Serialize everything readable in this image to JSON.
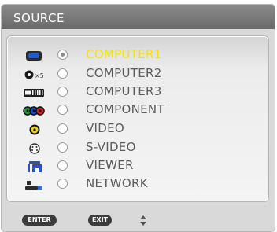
{
  "window": {
    "title": "SOURCE"
  },
  "sources": [
    {
      "label": "COMPUTER1",
      "selected": true,
      "icon": "computer-port-icon"
    },
    {
      "label": "COMPUTER2",
      "selected": false,
      "icon": "bnc-x5-icon",
      "icon_text": "×5"
    },
    {
      "label": "COMPUTER3",
      "selected": false,
      "icon": "dvi-port-icon"
    },
    {
      "label": "COMPONENT",
      "selected": false,
      "icon": "component-rca-icon"
    },
    {
      "label": "VIDEO",
      "selected": false,
      "icon": "video-rca-icon"
    },
    {
      "label": "S-VIDEO",
      "selected": false,
      "icon": "s-video-icon"
    },
    {
      "label": "VIEWER",
      "selected": false,
      "icon": "viewer-icon"
    },
    {
      "label": "NETWORK",
      "selected": false,
      "icon": "network-icon"
    }
  ],
  "footer": {
    "enter_label": "ENTER",
    "exit_label": "EXIT",
    "nav_icon": "up-down-arrows-icon"
  },
  "colors": {
    "selected_text": "#f4e500",
    "normal_text": "#5c5c5c",
    "title_bar": "#7a7a7a"
  }
}
